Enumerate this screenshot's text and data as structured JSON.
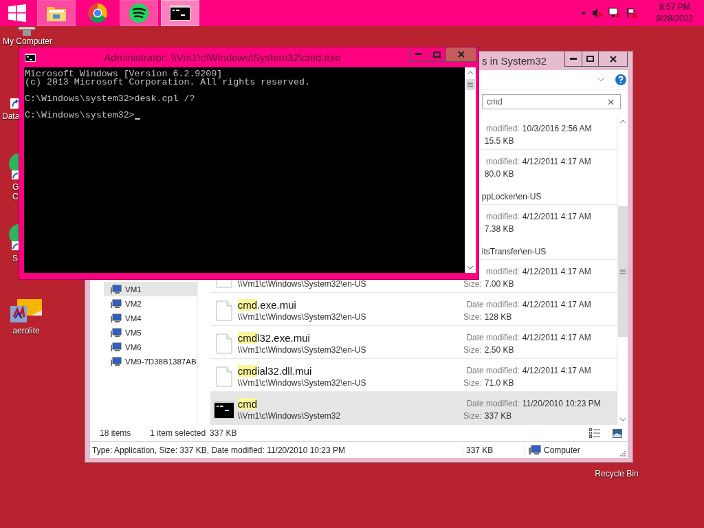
{
  "taskbar": {
    "apps": [
      {
        "kind": "folder",
        "open": true,
        "selected": false
      },
      {
        "kind": "browser",
        "open": false,
        "selected": false
      },
      {
        "kind": "music",
        "open": true,
        "selected": false
      },
      {
        "kind": "terminal",
        "open": true,
        "selected": true
      }
    ],
    "tray": {
      "time": "8:57 PM",
      "date": "8/28/2022"
    }
  },
  "desktop_icons": [
    {
      "kind": "computer",
      "lines": [
        "My Computer"
      ]
    },
    {
      "kind": "shortcut",
      "lines": [
        "Data"
      ]
    },
    {
      "kind": "green-app",
      "lines": [
        "G",
        "C"
      ]
    },
    {
      "kind": "green-app",
      "lines": [
        "S"
      ]
    },
    {
      "kind": "paint",
      "lines": [
        "aerolite"
      ]
    },
    {
      "lines": [
        "Recycle Bin"
      ]
    }
  ],
  "explorer": {
    "title": "s in System32",
    "search": {
      "value": "cmd"
    },
    "nav_items": [
      {
        "label": "VM1",
        "selected": true
      },
      {
        "label": "VM2",
        "selected": false
      },
      {
        "label": "VM4",
        "selected": false
      },
      {
        "label": "VM5",
        "selected": false
      },
      {
        "label": "VM6",
        "selected": false
      },
      {
        "label": "VM9-7D38B1387AB",
        "selected": false
      }
    ],
    "results": [
      {
        "date_label": "modified:",
        "date": "10/3/2016 2:56 AM",
        "size": "15.5 KB",
        "selected": false
      },
      {
        "date_label": "modified:",
        "date": "4/12/2011 4:17 AM",
        "size": "80.0 KB",
        "extra": "ppLocker\\en-US",
        "selected": false
      },
      {
        "date_label": "modified:",
        "date": "4/12/2011 4:17 AM",
        "size": "7.38 KB",
        "extra": "itsTransfer\\en-US",
        "selected": false
      },
      {
        "kind": "document",
        "path": "\\\\Vm1\\c\\Windows\\System32\\en-US",
        "date_label": "modified:",
        "date": "4/12/2011 4:17 AM",
        "size_label": "Size:",
        "size": "7.00 KB",
        "selected": false
      },
      {
        "kind": "document",
        "match": "cmd",
        "rest": ".exe.mui",
        "path": "\\\\Vm1\\c\\Windows\\System32\\en-US",
        "date_label": "Date modified:",
        "date": "4/12/2011 4:17 AM",
        "size_label": "Size:",
        "size": "128 KB",
        "selected": false
      },
      {
        "kind": "document",
        "match": "cmd",
        "rest": "l32.exe.mui",
        "path": "\\\\Vm1\\c\\Windows\\System32\\en-US",
        "date_label": "Date modified:",
        "date": "4/12/2011 4:17 AM",
        "size_label": "Size:",
        "size": "2.50 KB",
        "selected": false
      },
      {
        "kind": "document",
        "match": "cmd",
        "rest": "ial32.dll.mui",
        "path": "\\\\Vm1\\c\\Windows\\System32\\en-US",
        "date_label": "Date modified:",
        "date": "4/12/2011 4:17 AM",
        "size_label": "Size:",
        "size": "71.0 KB",
        "selected": false
      },
      {
        "kind": "terminal",
        "match": "cmd",
        "path": "\\\\Vm1\\c\\Windows\\System32",
        "date_label": "Date modified:",
        "date": "11/20/2010 10:23 PM",
        "size_label": "Size:",
        "size": "337 KB",
        "selected": true
      }
    ],
    "status": {
      "count": "18 items",
      "selection": "1 item selected",
      "size": "337 KB"
    },
    "status_bar": {
      "info": "Type: Application, Size: 337 KB, Date modified: 11/20/2010 10:23 PM",
      "size": "337 KB",
      "location": "Computer"
    }
  },
  "cmd": {
    "title": "Administrator: \\\\Vm1\\c\\Windows\\System32\\cmd.exe",
    "console": {
      "blocks": [
        [
          "Microsoft Windows [Version 6.2.9200]",
          "(c) 2013 Microsoft Corporation. All rights reserved."
        ],
        [
          "C:\\Windows\\system32>desk.cpl /?"
        ],
        [
          "C:\\Windows\\system32>"
        ]
      ],
      "cursor": true
    }
  }
}
